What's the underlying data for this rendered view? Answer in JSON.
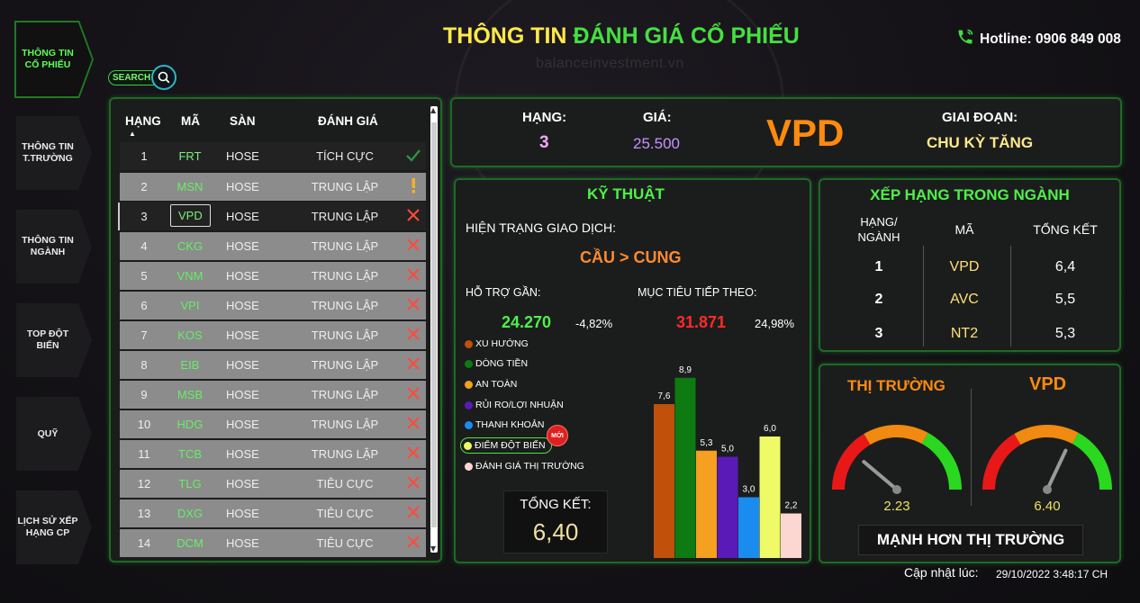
{
  "header": {
    "title_part1": "THÔNG TIN ",
    "title_part2": "ĐÁNH GIÁ CỔ PHIẾU",
    "hotline": "Hotline: 0906 849 008",
    "watermark": "balanceinvestment.vn",
    "search_label": "SEARCH"
  },
  "nav": [
    {
      "label": "THÔNG TIN CỔ PHIẾU",
      "active": true
    },
    {
      "label": "THÔNG TIN T.TRƯỜNG",
      "active": false
    },
    {
      "label": "THÔNG TIN NGÀNH",
      "active": false
    },
    {
      "label": "TOP ĐỘT BIẾN",
      "active": false
    },
    {
      "label": "QUỸ",
      "active": false
    },
    {
      "label": "LỊCH SỬ XẾP HẠNG CP",
      "active": false
    }
  ],
  "table": {
    "headers": {
      "rank": "HẠNG",
      "code": "MÃ",
      "exchange": "SÀN",
      "rating": "ĐÁNH GIÁ"
    },
    "rows": [
      {
        "rank": "1",
        "code": "FRT",
        "exchange": "HOSE",
        "rating": "TÍCH CỰC",
        "mark": "check"
      },
      {
        "rank": "2",
        "code": "MSN",
        "exchange": "HOSE",
        "rating": "TRUNG LẬP",
        "mark": "warn"
      },
      {
        "rank": "3",
        "code": "VPD",
        "exchange": "HOSE",
        "rating": "TRUNG LẬP",
        "mark": "x"
      },
      {
        "rank": "4",
        "code": "CKG",
        "exchange": "HOSE",
        "rating": "TRUNG LẬP",
        "mark": "x"
      },
      {
        "rank": "5",
        "code": "VNM",
        "exchange": "HOSE",
        "rating": "TRUNG LẬP",
        "mark": "x"
      },
      {
        "rank": "6",
        "code": "VPI",
        "exchange": "HOSE",
        "rating": "TRUNG LẬP",
        "mark": "x"
      },
      {
        "rank": "7",
        "code": "KOS",
        "exchange": "HOSE",
        "rating": "TRUNG LẬP",
        "mark": "x"
      },
      {
        "rank": "8",
        "code": "EIB",
        "exchange": "HOSE",
        "rating": "TRUNG LẬP",
        "mark": "x"
      },
      {
        "rank": "9",
        "code": "MSB",
        "exchange": "HOSE",
        "rating": "TRUNG LẬP",
        "mark": "x"
      },
      {
        "rank": "10",
        "code": "HDG",
        "exchange": "HOSE",
        "rating": "TRUNG LẬP",
        "mark": "x"
      },
      {
        "rank": "11",
        "code": "TCB",
        "exchange": "HOSE",
        "rating": "TRUNG LẬP",
        "mark": "x"
      },
      {
        "rank": "12",
        "code": "TLG",
        "exchange": "HOSE",
        "rating": "TIÊU CỰC",
        "mark": "x"
      },
      {
        "rank": "13",
        "code": "DXG",
        "exchange": "HOSE",
        "rating": "TIÊU CỰC",
        "mark": "x"
      },
      {
        "rank": "14",
        "code": "DCM",
        "exchange": "HOSE",
        "rating": "TIÊU CỰC",
        "mark": "x"
      }
    ]
  },
  "summary": {
    "rank_label": "HẠNG:",
    "rank_value": "3",
    "price_label": "GIÁ:",
    "price_value": "25.500",
    "ticker": "VPD",
    "phase_label": "GIAI ĐOẠN:",
    "phase_value": "CHU KỲ TĂNG"
  },
  "technical": {
    "title": "KỸ THUẬT",
    "status_label": "HIỆN TRẠNG GIAO DỊCH:",
    "status_value": "CẦU > CUNG",
    "support_label": "HỖ TRỢ GẦN:",
    "support_value": "24.270",
    "support_pct": "-4,82%",
    "target_label": "MỤC TIÊU TIẾP THEO:",
    "target_value": "31.871",
    "target_pct": "24,98%",
    "new_badge": "MỚI",
    "total_label": "TỔNG KẾT:",
    "total_value": "6,40",
    "legend": [
      {
        "name": "XU HƯỚNG",
        "color": "#c0500a"
      },
      {
        "name": "DÒNG TIỀN",
        "color": "#0e7a12"
      },
      {
        "name": "AN TOÀN",
        "color": "#f5a020"
      },
      {
        "name": "RỦI RO/LỢI NHUẬN",
        "color": "#5a1ab8"
      },
      {
        "name": "THANH KHOẢN",
        "color": "#1a8cf0"
      },
      {
        "name": "ĐIỂM ĐỘT BIẾN",
        "color": "#eefa66"
      },
      {
        "name": "ĐÁNH GIÁ THỊ TRƯỜNG",
        "color": "#fcd6d0"
      }
    ]
  },
  "chart_data": {
    "type": "bar",
    "categories": [
      "XU HƯỚNG",
      "DÒNG TIỀN",
      "AN TOÀN",
      "RỦI RO/LỢI NHUẬN",
      "THANH KHOẢN",
      "ĐIỂM ĐỘT BIẾN",
      "ĐÁNH GIÁ THỊ TRƯỜNG"
    ],
    "values": [
      7.6,
      8.9,
      5.3,
      5.0,
      3.0,
      6.0,
      2.2
    ],
    "labels": [
      "7,6",
      "8,9",
      "5,3",
      "5,0",
      "3,0",
      "6,0",
      "2,2"
    ],
    "colors": [
      "#c0500a",
      "#0e7a12",
      "#f5a020",
      "#5a1ab8",
      "#1a8cf0",
      "#eefa66",
      "#fcd6d0"
    ],
    "ylim": [
      0,
      10
    ]
  },
  "industry": {
    "title": "XẾP HẠNG TRONG NGÀNH",
    "headers": {
      "rank": "HẠNG/ NGÀNH",
      "code": "MÃ",
      "total": "TỔNG KẾT"
    },
    "rows": [
      {
        "rank": "1",
        "code": "VPD",
        "total": "6,4"
      },
      {
        "rank": "2",
        "code": "AVC",
        "total": "5,5"
      },
      {
        "rank": "3",
        "code": "NT2",
        "total": "5,3"
      }
    ]
  },
  "market": {
    "title_left": "THỊ TRƯỜNG",
    "title_right": "VPD",
    "gauge_left_value": "2.23",
    "gauge_left_num": 2.23,
    "gauge_right_value": "6.40",
    "gauge_right_num": 6.4,
    "gauge_max": 10,
    "conclusion": "MẠNH HƠN THỊ TRƯỜNG"
  },
  "updated": {
    "label": "Cập nhật lúc:",
    "value": "29/10/2022 3:48:17 CH"
  }
}
